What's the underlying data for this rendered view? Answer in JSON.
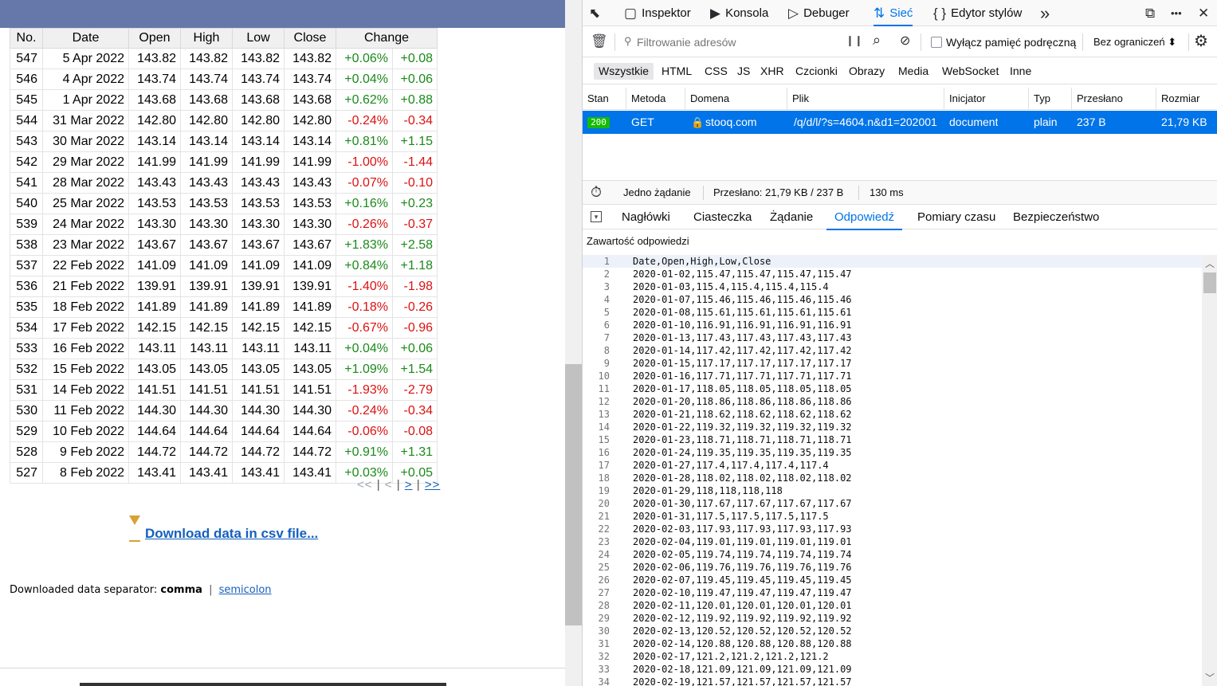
{
  "quotes_table": {
    "headers": [
      "No.",
      "Date",
      "Open",
      "High",
      "Low",
      "Close",
      "Change"
    ],
    "rows": [
      {
        "no": "547",
        "date": "5 Apr 2022",
        "open": "143.82",
        "high": "143.82",
        "low": "143.82",
        "close": "143.82",
        "chg_pct": "+0.06%",
        "chg_abs": "+0.08",
        "dir": "pos"
      },
      {
        "no": "546",
        "date": "4 Apr 2022",
        "open": "143.74",
        "high": "143.74",
        "low": "143.74",
        "close": "143.74",
        "chg_pct": "+0.04%",
        "chg_abs": "+0.06",
        "dir": "pos"
      },
      {
        "no": "545",
        "date": "1 Apr 2022",
        "open": "143.68",
        "high": "143.68",
        "low": "143.68",
        "close": "143.68",
        "chg_pct": "+0.62%",
        "chg_abs": "+0.88",
        "dir": "pos"
      },
      {
        "no": "544",
        "date": "31 Mar 2022",
        "open": "142.80",
        "high": "142.80",
        "low": "142.80",
        "close": "142.80",
        "chg_pct": "-0.24%",
        "chg_abs": "-0.34",
        "dir": "neg"
      },
      {
        "no": "543",
        "date": "30 Mar 2022",
        "open": "143.14",
        "high": "143.14",
        "low": "143.14",
        "close": "143.14",
        "chg_pct": "+0.81%",
        "chg_abs": "+1.15",
        "dir": "pos"
      },
      {
        "no": "542",
        "date": "29 Mar 2022",
        "open": "141.99",
        "high": "141.99",
        "low": "141.99",
        "close": "141.99",
        "chg_pct": "-1.00%",
        "chg_abs": "-1.44",
        "dir": "neg"
      },
      {
        "no": "541",
        "date": "28 Mar 2022",
        "open": "143.43",
        "high": "143.43",
        "low": "143.43",
        "close": "143.43",
        "chg_pct": "-0.07%",
        "chg_abs": "-0.10",
        "dir": "neg"
      },
      {
        "no": "540",
        "date": "25 Mar 2022",
        "open": "143.53",
        "high": "143.53",
        "low": "143.53",
        "close": "143.53",
        "chg_pct": "+0.16%",
        "chg_abs": "+0.23",
        "dir": "pos"
      },
      {
        "no": "539",
        "date": "24 Mar 2022",
        "open": "143.30",
        "high": "143.30",
        "low": "143.30",
        "close": "143.30",
        "chg_pct": "-0.26%",
        "chg_abs": "-0.37",
        "dir": "neg"
      },
      {
        "no": "538",
        "date": "23 Mar 2022",
        "open": "143.67",
        "high": "143.67",
        "low": "143.67",
        "close": "143.67",
        "chg_pct": "+1.83%",
        "chg_abs": "+2.58",
        "dir": "pos"
      },
      {
        "no": "537",
        "date": "22 Feb 2022",
        "open": "141.09",
        "high": "141.09",
        "low": "141.09",
        "close": "141.09",
        "chg_pct": "+0.84%",
        "chg_abs": "+1.18",
        "dir": "pos"
      },
      {
        "no": "536",
        "date": "21 Feb 2022",
        "open": "139.91",
        "high": "139.91",
        "low": "139.91",
        "close": "139.91",
        "chg_pct": "-1.40%",
        "chg_abs": "-1.98",
        "dir": "neg"
      },
      {
        "no": "535",
        "date": "18 Feb 2022",
        "open": "141.89",
        "high": "141.89",
        "low": "141.89",
        "close": "141.89",
        "chg_pct": "-0.18%",
        "chg_abs": "-0.26",
        "dir": "neg"
      },
      {
        "no": "534",
        "date": "17 Feb 2022",
        "open": "142.15",
        "high": "142.15",
        "low": "142.15",
        "close": "142.15",
        "chg_pct": "-0.67%",
        "chg_abs": "-0.96",
        "dir": "neg"
      },
      {
        "no": "533",
        "date": "16 Feb 2022",
        "open": "143.11",
        "high": "143.11",
        "low": "143.11",
        "close": "143.11",
        "chg_pct": "+0.04%",
        "chg_abs": "+0.06",
        "dir": "pos"
      },
      {
        "no": "532",
        "date": "15 Feb 2022",
        "open": "143.05",
        "high": "143.05",
        "low": "143.05",
        "close": "143.05",
        "chg_pct": "+1.09%",
        "chg_abs": "+1.54",
        "dir": "pos"
      },
      {
        "no": "531",
        "date": "14 Feb 2022",
        "open": "141.51",
        "high": "141.51",
        "low": "141.51",
        "close": "141.51",
        "chg_pct": "-1.93%",
        "chg_abs": "-2.79",
        "dir": "neg"
      },
      {
        "no": "530",
        "date": "11 Feb 2022",
        "open": "144.30",
        "high": "144.30",
        "low": "144.30",
        "close": "144.30",
        "chg_pct": "-0.24%",
        "chg_abs": "-0.34",
        "dir": "neg"
      },
      {
        "no": "529",
        "date": "10 Feb 2022",
        "open": "144.64",
        "high": "144.64",
        "low": "144.64",
        "close": "144.64",
        "chg_pct": "-0.06%",
        "chg_abs": "-0.08",
        "dir": "neg"
      },
      {
        "no": "528",
        "date": "9 Feb 2022",
        "open": "144.72",
        "high": "144.72",
        "low": "144.72",
        "close": "144.72",
        "chg_pct": "+0.91%",
        "chg_abs": "+1.31",
        "dir": "pos"
      },
      {
        "no": "527",
        "date": "8 Feb 2022",
        "open": "143.41",
        "high": "143.41",
        "low": "143.41",
        "close": "143.41",
        "chg_pct": "+0.03%",
        "chg_abs": "+0.05",
        "dir": "pos"
      }
    ]
  },
  "pager": {
    "first": "<<",
    "prev": "<",
    "next": ">",
    "last": ">>",
    "sep": "|"
  },
  "download": {
    "label": "Download data in csv file..."
  },
  "separator": {
    "label": "Downloaded data separator:",
    "current": "comma",
    "bar": "|",
    "alt": "semicolon"
  },
  "devtools": {
    "tabs": [
      {
        "icon": "⬉",
        "label": "",
        "name": "pick-element"
      },
      {
        "icon": "▢",
        "label": "Inspektor",
        "name": "inspector"
      },
      {
        "icon": "▶",
        "label": "Konsola",
        "name": "console"
      },
      {
        "icon": "▷",
        "label": "Debuger",
        "name": "debugger"
      },
      {
        "icon": "⇅",
        "label": "Sieć",
        "name": "network"
      },
      {
        "icon": "{ }",
        "label": "Edytor stylów",
        "name": "style-editor"
      },
      {
        "icon": "»",
        "label": "",
        "name": "more-tools"
      }
    ],
    "toolbar_right": {
      "dock": "⧉",
      "menu": "•••",
      "close": "✕"
    },
    "filter": {
      "placeholder": "Filtrowanie adresów",
      "pause": "❙❙",
      "disable_cache": "Wyłącz pamięć podręczną",
      "throttle": "Bez ograniczeń ⬍"
    },
    "type_filters": [
      "Wszystkie",
      "HTML",
      "CSS",
      "JS",
      "XHR",
      "Czcionki",
      "Obrazy",
      "Media",
      "WebSocket",
      "Inne"
    ],
    "columns": [
      "Stan",
      "Metoda",
      "Domena",
      "Plik",
      "Inicjator",
      "Typ",
      "Przesłano",
      "Rozmiar"
    ],
    "request": {
      "status": "200",
      "method": "GET",
      "domain": "stooq.com",
      "file": "/q/d/l/?s=4604.n&d1=202001",
      "initiator": "document",
      "type": "plain",
      "transferred": "237 B",
      "size": "21,79 KB"
    },
    "summary": {
      "requests": "Jedno żądanie",
      "transferred": "Przesłano: 21,79 KB / 237 B",
      "time": "130 ms"
    },
    "detail_tabs": [
      "Nagłówki",
      "Ciasteczka",
      "Żądanie",
      "Odpowiedź",
      "Pomiary czasu",
      "Bezpieczeństwo"
    ],
    "response_label": "Zawartość odpowiedzi",
    "response_lines": [
      "Date,Open,High,Low,Close",
      "2020-01-02,115.47,115.47,115.47,115.47",
      "2020-01-03,115.4,115.4,115.4,115.4",
      "2020-01-07,115.46,115.46,115.46,115.46",
      "2020-01-08,115.61,115.61,115.61,115.61",
      "2020-01-10,116.91,116.91,116.91,116.91",
      "2020-01-13,117.43,117.43,117.43,117.43",
      "2020-01-14,117.42,117.42,117.42,117.42",
      "2020-01-15,117.17,117.17,117.17,117.17",
      "2020-01-16,117.71,117.71,117.71,117.71",
      "2020-01-17,118.05,118.05,118.05,118.05",
      "2020-01-20,118.86,118.86,118.86,118.86",
      "2020-01-21,118.62,118.62,118.62,118.62",
      "2020-01-22,119.32,119.32,119.32,119.32",
      "2020-01-23,118.71,118.71,118.71,118.71",
      "2020-01-24,119.35,119.35,119.35,119.35",
      "2020-01-27,117.4,117.4,117.4,117.4",
      "2020-01-28,118.02,118.02,118.02,118.02",
      "2020-01-29,118,118,118,118",
      "2020-01-30,117.67,117.67,117.67,117.67",
      "2020-01-31,117.5,117.5,117.5,117.5",
      "2020-02-03,117.93,117.93,117.93,117.93",
      "2020-02-04,119.01,119.01,119.01,119.01",
      "2020-02-05,119.74,119.74,119.74,119.74",
      "2020-02-06,119.76,119.76,119.76,119.76",
      "2020-02-07,119.45,119.45,119.45,119.45",
      "2020-02-10,119.47,119.47,119.47,119.47",
      "2020-02-11,120.01,120.01,120.01,120.01",
      "2020-02-12,119.92,119.92,119.92,119.92",
      "2020-02-13,120.52,120.52,120.52,120.52",
      "2020-02-14,120.88,120.88,120.88,120.88",
      "2020-02-17,121.2,121.2,121.2,121.2",
      "2020-02-18,121.09,121.09,121.09,121.09",
      "2020-02-19,121.57,121.57,121.57,121.57"
    ]
  },
  "colors": {
    "banner": "#6678a9",
    "positive": "#1a8a1a",
    "negative": "#dd1111",
    "accent": "#0074e8",
    "status_ok": "#12bc00"
  }
}
